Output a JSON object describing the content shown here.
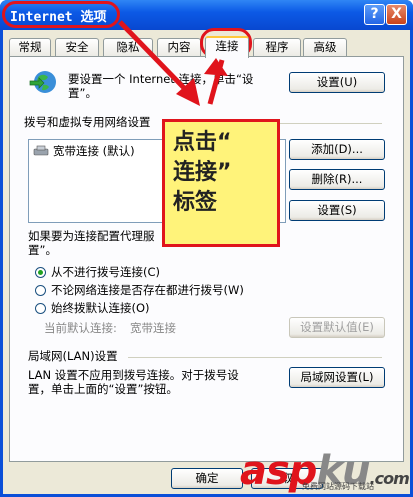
{
  "window": {
    "title": "Internet 选项",
    "help_glyph": "?",
    "close_glyph": "X"
  },
  "tabs": [
    {
      "label": "常规"
    },
    {
      "label": "安全"
    },
    {
      "label": "隐私"
    },
    {
      "label": "内容"
    },
    {
      "label": "连接"
    },
    {
      "label": "程序"
    },
    {
      "label": "高级"
    }
  ],
  "setup": {
    "text_line1": "要设置一个 Internet 连接，单击“设",
    "text_line2": "置”。",
    "button": "设置(U)"
  },
  "dialup": {
    "group_label": "拨号和虚拟专用网络设置",
    "connections": [
      {
        "label": "宽带连接 (默认)"
      }
    ],
    "add_button": "添加(D)...",
    "remove_button": "删除(R)...",
    "settings_button": "设置(S)"
  },
  "proxy": {
    "text_line1": "如果要为连接配置代理服",
    "text_line2": "置”。"
  },
  "radios": [
    {
      "label": "从不进行拨号连接(C)",
      "selected": true
    },
    {
      "label": "不论网络连接是否存在都进行拨号(W)",
      "selected": false
    },
    {
      "label": "始终拨默认连接(O)",
      "selected": false
    }
  ],
  "default_connection": {
    "label": "当前默认连接:",
    "value": "宽带连接",
    "button": "设置默认值(E)"
  },
  "lan": {
    "group_label": "局域网(LAN)设置",
    "text_line1": "LAN 设置不应用到拨号连接。对于拨号设",
    "text_line2": "置，单击上面的“设置”按钮。",
    "button": "局域网设置(L)"
  },
  "footer": {
    "ok_button": "确定",
    "cancel_button": "取"
  },
  "annotation": {
    "line1": "点击“",
    "line2": "连接”",
    "line3": "标签"
  },
  "watermark": {
    "brand_a": "asp",
    "brand_b": "ku",
    "brand_c": ".com",
    "subtitle": "免费网站源码下载站"
  },
  "colors": {
    "accent_red": "#e0141c",
    "callout_bg": "#fff37a",
    "titlebar_blue": "#0c5ae6"
  }
}
